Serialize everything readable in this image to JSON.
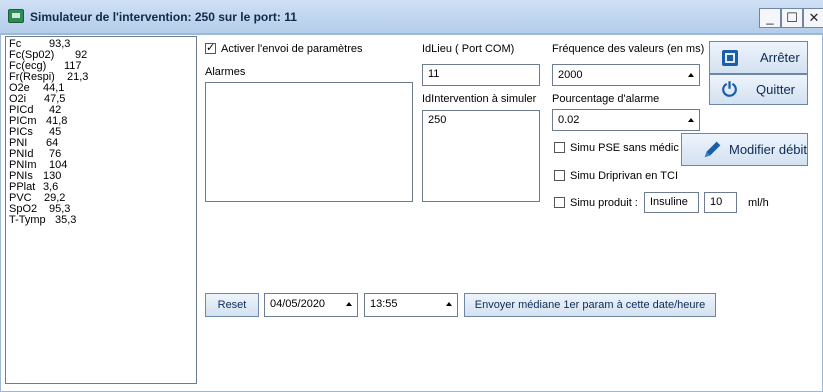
{
  "window": {
    "title": "Simulateur de l'intervention: 250 sur le port: 11",
    "minimize": "_",
    "maximize": "☐",
    "close": "✕"
  },
  "params_list": [
    {
      "name": "Fc",
      "value": "93,3"
    },
    {
      "name": "Fc(Sp02)",
      "value": "92"
    },
    {
      "name": "Fc(ecg)",
      "value": "117"
    },
    {
      "name": "Fr(Respi)",
      "value": "21,3"
    },
    {
      "name": "O2e",
      "value": "44,1"
    },
    {
      "name": "O2i",
      "value": "47,5"
    },
    {
      "name": "PICd",
      "value": "42"
    },
    {
      "name": "PICm",
      "value": "41,8"
    },
    {
      "name": "PICs",
      "value": "45"
    },
    {
      "name": "PNI",
      "value": "64"
    },
    {
      "name": "PNId",
      "value": "76"
    },
    {
      "name": "PNIm",
      "value": "104"
    },
    {
      "name": "PNIs",
      "value": "130"
    },
    {
      "name": "PPlat",
      "value": "3,6"
    },
    {
      "name": "PVC",
      "value": "29,2"
    },
    {
      "name": "SpO2",
      "value": "95,3"
    },
    {
      "name": "T-Tymp",
      "value": "35,3"
    }
  ],
  "activate": {
    "label": "Activer l'envoi de paramètres",
    "checked": true
  },
  "alarms": {
    "label": "Alarmes",
    "value": ""
  },
  "idlieu": {
    "label": "IdLieu ( Port COM)",
    "value": "11"
  },
  "idintervention": {
    "label": "IdIntervention à simuler",
    "value": "250"
  },
  "frequency": {
    "label": "Fréquence des valeurs (en ms)",
    "value": "2000"
  },
  "alarm_pct": {
    "label": "Pourcentage d'alarme",
    "value": "0.02"
  },
  "buttons": {
    "stop": "Arrêter",
    "quit": "Quitter",
    "modify": "Modifier débit",
    "reset": "Reset",
    "send": "Envoyer médiane 1er param à cette date/heure"
  },
  "simu_pse": {
    "label": "Simu PSE sans médic",
    "checked": false
  },
  "simu_dripivan": {
    "label": "Simu Driprivan en TCI",
    "checked": false
  },
  "simu_produit": {
    "label": "Simu produit :",
    "checked": false,
    "product": "Insuline",
    "rate": "10",
    "unit": "ml/h"
  },
  "date": "04/05/2020",
  "time": "13:55",
  "icons": {
    "stop": "stop-square-icon",
    "quit": "power-icon",
    "modify": "pen-icon",
    "app": "app-window-icon"
  },
  "colors": {
    "titlebar": "#cfe0f5",
    "accent": "#1a5ea8"
  }
}
